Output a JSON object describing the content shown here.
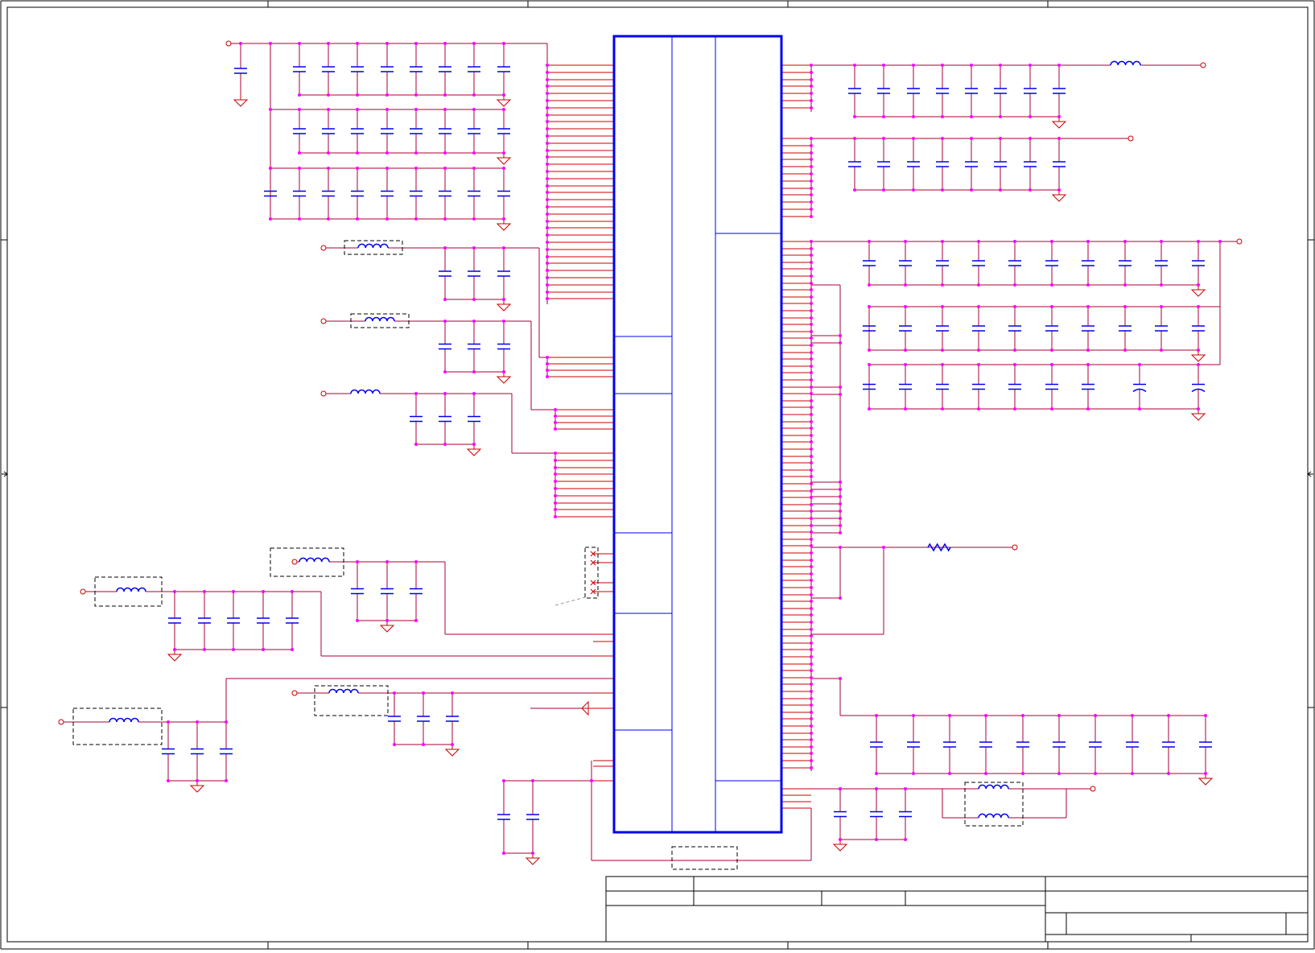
{
  "sheet": {
    "colors": {
      "border": "#000000",
      "wire": "#aa0033",
      "pin": "#cc0000",
      "junction": "#ff00ff",
      "component": "#0000ee",
      "ic_outline": "#0000ee",
      "ground": "#cc0000",
      "port": "#cc0000",
      "dashed_box": "#000000"
    },
    "zones": {
      "top_ticks": 5,
      "side_ticks": 3
    }
  },
  "schematic": {
    "icons": [
      "capacitor-icon",
      "inductor-icon",
      "resistor-icon",
      "ground-icon",
      "port-icon",
      "no-connect-icon",
      "polarized-capacitor-icon"
    ]
  }
}
